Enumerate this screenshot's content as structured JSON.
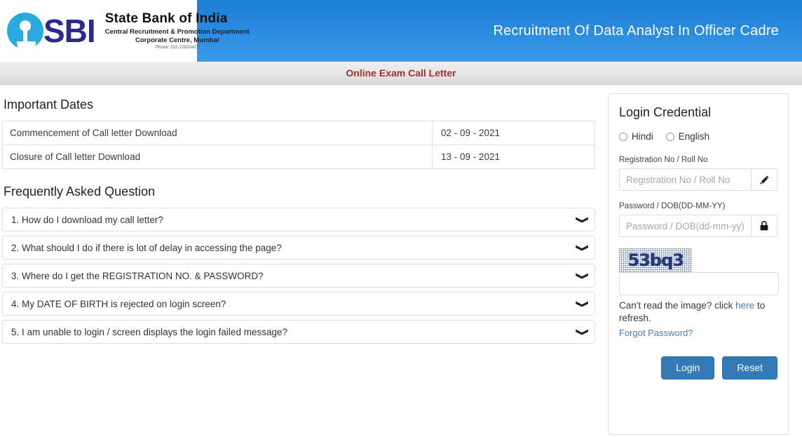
{
  "header": {
    "bank_name": "State Bank of India",
    "department": "Central Recruitment & Promotion Department",
    "address": "Corporate Centre, Mumbai",
    "phone": "Phone: 022-22820427",
    "logo_text": "SBI",
    "title": "Recruitment Of Data Analyst In Officer Cadre",
    "gradient_top": "#1b7fd4",
    "gradient_bottom": "#3a9bea"
  },
  "subbar": {
    "text": "Online Exam Call Letter",
    "color": "#a33030"
  },
  "important_dates": {
    "heading": "Important Dates",
    "rows": [
      {
        "label": "Commencement of Call letter Download",
        "date": "02 - 09 - 2021"
      },
      {
        "label": "Closure of Call letter Download",
        "date": "13 - 09 - 2021"
      }
    ]
  },
  "faq": {
    "heading": "Frequently Asked Question",
    "items": [
      {
        "question": "1. How do I download my call letter?",
        "chevron": "chevron-down-icon"
      },
      {
        "question": "2. What should I do if there is lot of delay in accessing the page?",
        "chevron": "chevron-down-icon"
      },
      {
        "question": "3. Where do I get the REGISTRATION NO. & PASSWORD?",
        "chevron": "chevron-down-icon"
      },
      {
        "question": "4. My DATE OF BIRTH is rejected on login screen?",
        "chevron": "chevron-down-icon"
      },
      {
        "question": "5. I am unable to login / screen displays the login failed message?",
        "chevron": "chevron-down-icon"
      }
    ]
  },
  "login": {
    "heading": "Login Credential",
    "language": {
      "options": [
        {
          "label": "Hindi",
          "selected": false
        },
        {
          "label": "English",
          "selected": false
        }
      ]
    },
    "registration": {
      "label": "Registration No / Roll No",
      "placeholder": "Registration No / Roll No",
      "value": "",
      "addon_icon": "pencil-icon"
    },
    "password": {
      "label": "Password / DOB(DD-MM-YY)",
      "placeholder": "Password / DOB(dd-mm-yy)",
      "value": "",
      "addon_icon": "lock-icon"
    },
    "captcha": {
      "text": "53bq3",
      "input_value": "",
      "input_placeholder": "",
      "refresh_prefix": "Can't read the image? click ",
      "refresh_link": "here",
      "refresh_suffix": " to refresh.",
      "text_color": "#1f3c78"
    },
    "forgot_password": "Forgot Password?",
    "buttons": {
      "login": "Login",
      "reset": "Reset",
      "color": "#347ab6"
    }
  }
}
